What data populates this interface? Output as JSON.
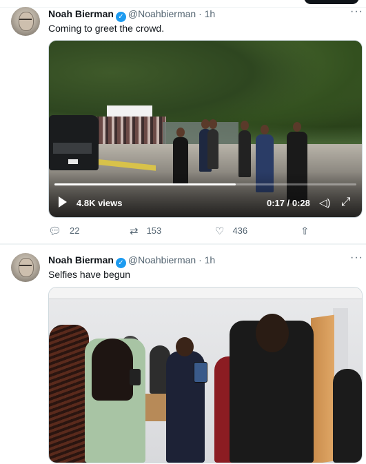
{
  "tweets": [
    {
      "name": "Noah Bierman",
      "handle": "@Noahbierman",
      "separator": "·",
      "time": "1h",
      "more": "···",
      "text": "Coming to greet the crowd.",
      "video": {
        "views": "4.8K views",
        "time": "0:17 / 0:28",
        "progress_fraction": 0.6
      },
      "actions": {
        "replies": "22",
        "retweets": "153",
        "likes": "436"
      }
    },
    {
      "name": "Noah Bierman",
      "handle": "@Noahbierman",
      "separator": "·",
      "time": "1h",
      "more": "···",
      "text": "Selfies have begun"
    }
  ],
  "icons": {
    "verified": "verified-badge-icon",
    "reply": "reply-icon",
    "retweet": "retweet-icon",
    "like": "heart-icon",
    "share": "share-icon",
    "play": "play-icon",
    "volume": "volume-icon",
    "fullscreen": "fullscreen-icon"
  },
  "colors": {
    "verified": "#1d9bf0",
    "muted_text": "#536471",
    "text": "#0f1419"
  }
}
